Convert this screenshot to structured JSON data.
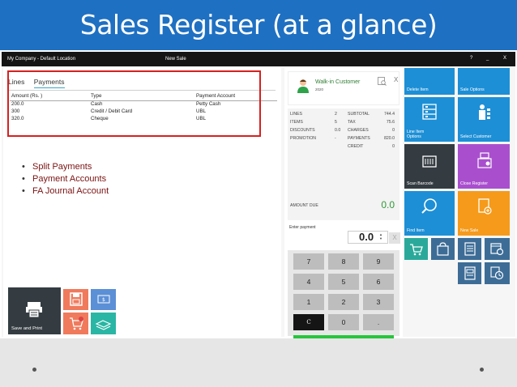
{
  "slide": {
    "title": "Sales Register (at a glance)",
    "bullets": [
      "Split Payments",
      "Payment Accounts",
      "FA Journal Account"
    ]
  },
  "window": {
    "company": "My Company - Default Location",
    "title": "New Sale",
    "controls": [
      "?",
      "_",
      "X"
    ]
  },
  "tabs": [
    {
      "label": "Lines",
      "active": false
    },
    {
      "label": "Payments",
      "active": true
    }
  ],
  "payments": {
    "headers": [
      "Amount (Rs. )",
      "Type",
      "Payment Account"
    ],
    "rows": [
      [
        "200.0",
        "Cash",
        "Petty Cash"
      ],
      [
        "300",
        "Credit / Debit Card",
        "UBL"
      ],
      [
        "320.0",
        "Cheque",
        "UBL"
      ]
    ]
  },
  "customer": {
    "name": "Walk-in Customer",
    "code": "2020",
    "close": "X"
  },
  "totals": [
    {
      "l1": "LINES",
      "v1": "2",
      "l2": "SUBTOTAL",
      "v2": "744.4"
    },
    {
      "l1": "ITEMS",
      "v1": "5",
      "l2": "TAX",
      "v2": "75.6"
    },
    {
      "l1": "DISCOUNTS",
      "v1": "0.0",
      "l2": "CHARGES",
      "v2": "0"
    },
    {
      "l1": "PROMOTION",
      "v1": "-",
      "l2": "PAYMENTS",
      "v2": "820.0"
    },
    {
      "l1": "",
      "v1": "",
      "l2": "CREDIT",
      "v2": "0"
    }
  ],
  "amount_due": {
    "label": "AMOUNT DUE",
    "value": "0.0"
  },
  "payment_entry": {
    "label": "Enter payment",
    "value": "0.0",
    "clear": "X"
  },
  "keypad": [
    "7",
    "8",
    "9",
    "4",
    "5",
    "6",
    "1",
    "2",
    "3",
    "C",
    "0",
    "."
  ],
  "actions": {
    "save_print": "Save and Print",
    "delete_item": "Delete Item",
    "sale_options": "Sale Options",
    "line_item_options": "Line Item Options",
    "select_customer": "Select Customer",
    "scan_barcode": "Scan Barcode",
    "close_register": "Close Register",
    "find_item": "Find Item",
    "new_sale": "New Sale"
  },
  "colors": {
    "header_blue": "#1e70c2",
    "tile_blue": "#1d8fd6",
    "tile_dark": "#343c42",
    "tile_purple": "#a94fce",
    "tile_orange": "#f59a1b",
    "tile_teal": "#2aa99a",
    "tile_steel": "#3d6d97",
    "enter_green": "#27c53c",
    "amount_green": "#2e9a36",
    "highlight_red": "#d72020"
  }
}
